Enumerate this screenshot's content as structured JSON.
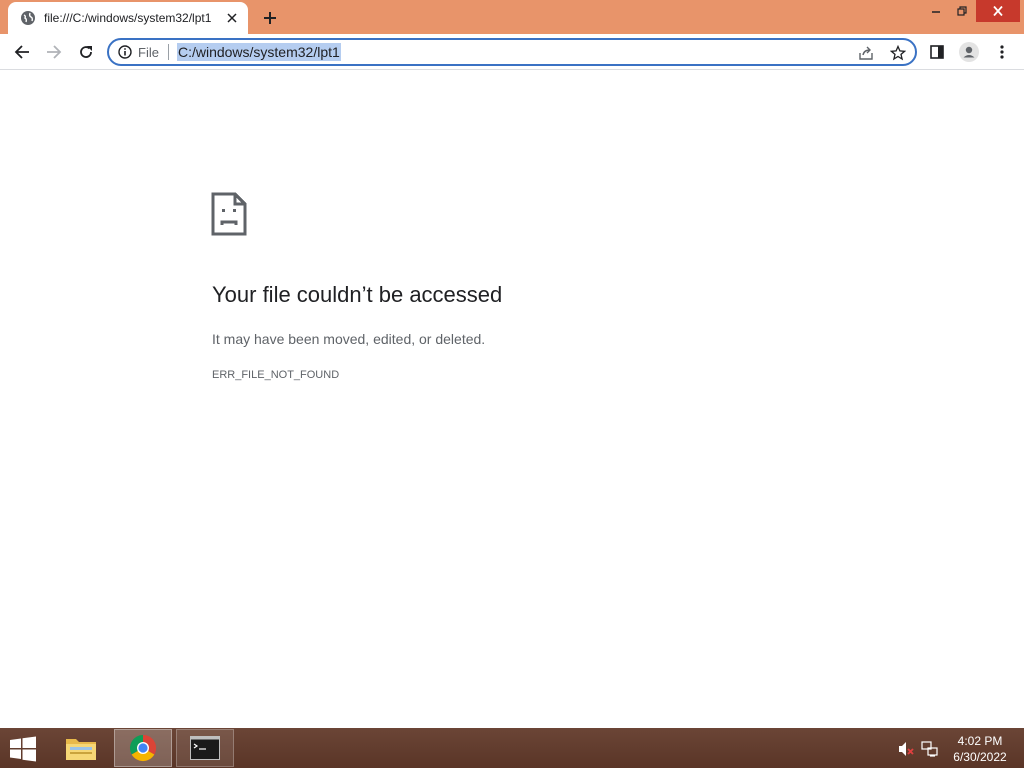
{
  "browser": {
    "tab": {
      "title": "file:///C:/windows/system32/lpt1"
    },
    "omnibox": {
      "site_label": "File",
      "url": "C:/windows/system32/lpt1"
    }
  },
  "error_page": {
    "title": "Your file couldn’t be accessed",
    "description": "It may have been moved, edited, or deleted.",
    "code": "ERR_FILE_NOT_FOUND"
  },
  "taskbar": {
    "time": "4:02 PM",
    "date": "6/30/2022"
  },
  "icons": [
    "globe-icon",
    "close-icon",
    "plus-icon",
    "minimize-icon",
    "restore-icon",
    "back-icon",
    "forward-icon",
    "reload-icon",
    "info-icon",
    "share-icon",
    "star-icon",
    "side-panel-icon",
    "profile-icon",
    "menu-icon",
    "sad-file-icon",
    "windows-start-icon",
    "folder-icon",
    "chrome-icon",
    "cmd-icon",
    "volume-muted-icon",
    "network-icon"
  ],
  "colors": {
    "title_bar": "#e8946a",
    "omnibox_border": "#3a72c4",
    "url_selection": "#b5cdf0",
    "window_close": "#c7392c",
    "taskbar": "#5a3527"
  }
}
